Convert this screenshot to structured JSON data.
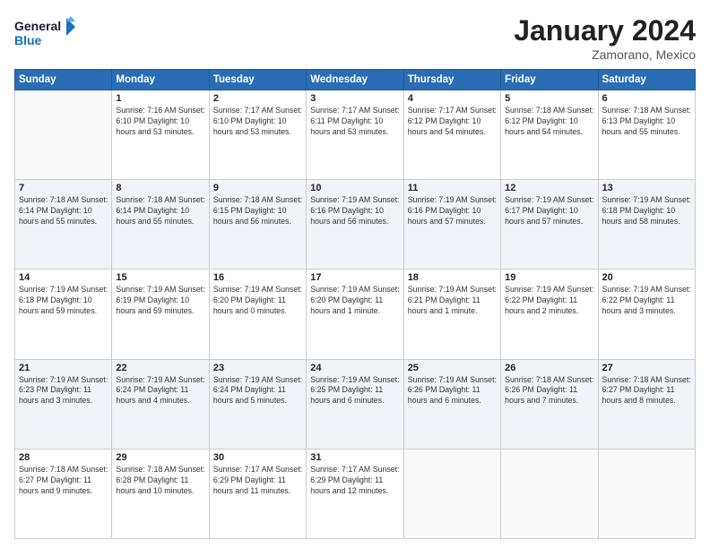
{
  "header": {
    "logo_line1": "General",
    "logo_line2": "Blue",
    "month": "January 2024",
    "location": "Zamorano, Mexico"
  },
  "weekdays": [
    "Sunday",
    "Monday",
    "Tuesday",
    "Wednesday",
    "Thursday",
    "Friday",
    "Saturday"
  ],
  "weeks": [
    [
      {
        "day": "",
        "info": ""
      },
      {
        "day": "1",
        "info": "Sunrise: 7:16 AM\nSunset: 6:10 PM\nDaylight: 10 hours\nand 53 minutes."
      },
      {
        "day": "2",
        "info": "Sunrise: 7:17 AM\nSunset: 6:10 PM\nDaylight: 10 hours\nand 53 minutes."
      },
      {
        "day": "3",
        "info": "Sunrise: 7:17 AM\nSunset: 6:11 PM\nDaylight: 10 hours\nand 53 minutes."
      },
      {
        "day": "4",
        "info": "Sunrise: 7:17 AM\nSunset: 6:12 PM\nDaylight: 10 hours\nand 54 minutes."
      },
      {
        "day": "5",
        "info": "Sunrise: 7:18 AM\nSunset: 6:12 PM\nDaylight: 10 hours\nand 54 minutes."
      },
      {
        "day": "6",
        "info": "Sunrise: 7:18 AM\nSunset: 6:13 PM\nDaylight: 10 hours\nand 55 minutes."
      }
    ],
    [
      {
        "day": "7",
        "info": "Sunrise: 7:18 AM\nSunset: 6:14 PM\nDaylight: 10 hours\nand 55 minutes."
      },
      {
        "day": "8",
        "info": "Sunrise: 7:18 AM\nSunset: 6:14 PM\nDaylight: 10 hours\nand 55 minutes."
      },
      {
        "day": "9",
        "info": "Sunrise: 7:18 AM\nSunset: 6:15 PM\nDaylight: 10 hours\nand 56 minutes."
      },
      {
        "day": "10",
        "info": "Sunrise: 7:19 AM\nSunset: 6:16 PM\nDaylight: 10 hours\nand 56 minutes."
      },
      {
        "day": "11",
        "info": "Sunrise: 7:19 AM\nSunset: 6:16 PM\nDaylight: 10 hours\nand 57 minutes."
      },
      {
        "day": "12",
        "info": "Sunrise: 7:19 AM\nSunset: 6:17 PM\nDaylight: 10 hours\nand 57 minutes."
      },
      {
        "day": "13",
        "info": "Sunrise: 7:19 AM\nSunset: 6:18 PM\nDaylight: 10 hours\nand 58 minutes."
      }
    ],
    [
      {
        "day": "14",
        "info": "Sunrise: 7:19 AM\nSunset: 6:18 PM\nDaylight: 10 hours\nand 59 minutes."
      },
      {
        "day": "15",
        "info": "Sunrise: 7:19 AM\nSunset: 6:19 PM\nDaylight: 10 hours\nand 59 minutes."
      },
      {
        "day": "16",
        "info": "Sunrise: 7:19 AM\nSunset: 6:20 PM\nDaylight: 11 hours\nand 0 minutes."
      },
      {
        "day": "17",
        "info": "Sunrise: 7:19 AM\nSunset: 6:20 PM\nDaylight: 11 hours\nand 1 minute."
      },
      {
        "day": "18",
        "info": "Sunrise: 7:19 AM\nSunset: 6:21 PM\nDaylight: 11 hours\nand 1 minute."
      },
      {
        "day": "19",
        "info": "Sunrise: 7:19 AM\nSunset: 6:22 PM\nDaylight: 11 hours\nand 2 minutes."
      },
      {
        "day": "20",
        "info": "Sunrise: 7:19 AM\nSunset: 6:22 PM\nDaylight: 11 hours\nand 3 minutes."
      }
    ],
    [
      {
        "day": "21",
        "info": "Sunrise: 7:19 AM\nSunset: 6:23 PM\nDaylight: 11 hours\nand 3 minutes."
      },
      {
        "day": "22",
        "info": "Sunrise: 7:19 AM\nSunset: 6:24 PM\nDaylight: 11 hours\nand 4 minutes."
      },
      {
        "day": "23",
        "info": "Sunrise: 7:19 AM\nSunset: 6:24 PM\nDaylight: 11 hours\nand 5 minutes."
      },
      {
        "day": "24",
        "info": "Sunrise: 7:19 AM\nSunset: 6:25 PM\nDaylight: 11 hours\nand 6 minutes."
      },
      {
        "day": "25",
        "info": "Sunrise: 7:19 AM\nSunset: 6:26 PM\nDaylight: 11 hours\nand 6 minutes."
      },
      {
        "day": "26",
        "info": "Sunrise: 7:18 AM\nSunset: 6:26 PM\nDaylight: 11 hours\nand 7 minutes."
      },
      {
        "day": "27",
        "info": "Sunrise: 7:18 AM\nSunset: 6:27 PM\nDaylight: 11 hours\nand 8 minutes."
      }
    ],
    [
      {
        "day": "28",
        "info": "Sunrise: 7:18 AM\nSunset: 6:27 PM\nDaylight: 11 hours\nand 9 minutes."
      },
      {
        "day": "29",
        "info": "Sunrise: 7:18 AM\nSunset: 6:28 PM\nDaylight: 11 hours\nand 10 minutes."
      },
      {
        "day": "30",
        "info": "Sunrise: 7:17 AM\nSunset: 6:29 PM\nDaylight: 11 hours\nand 11 minutes."
      },
      {
        "day": "31",
        "info": "Sunrise: 7:17 AM\nSunset: 6:29 PM\nDaylight: 11 hours\nand 12 minutes."
      },
      {
        "day": "",
        "info": ""
      },
      {
        "day": "",
        "info": ""
      },
      {
        "day": "",
        "info": ""
      }
    ]
  ]
}
